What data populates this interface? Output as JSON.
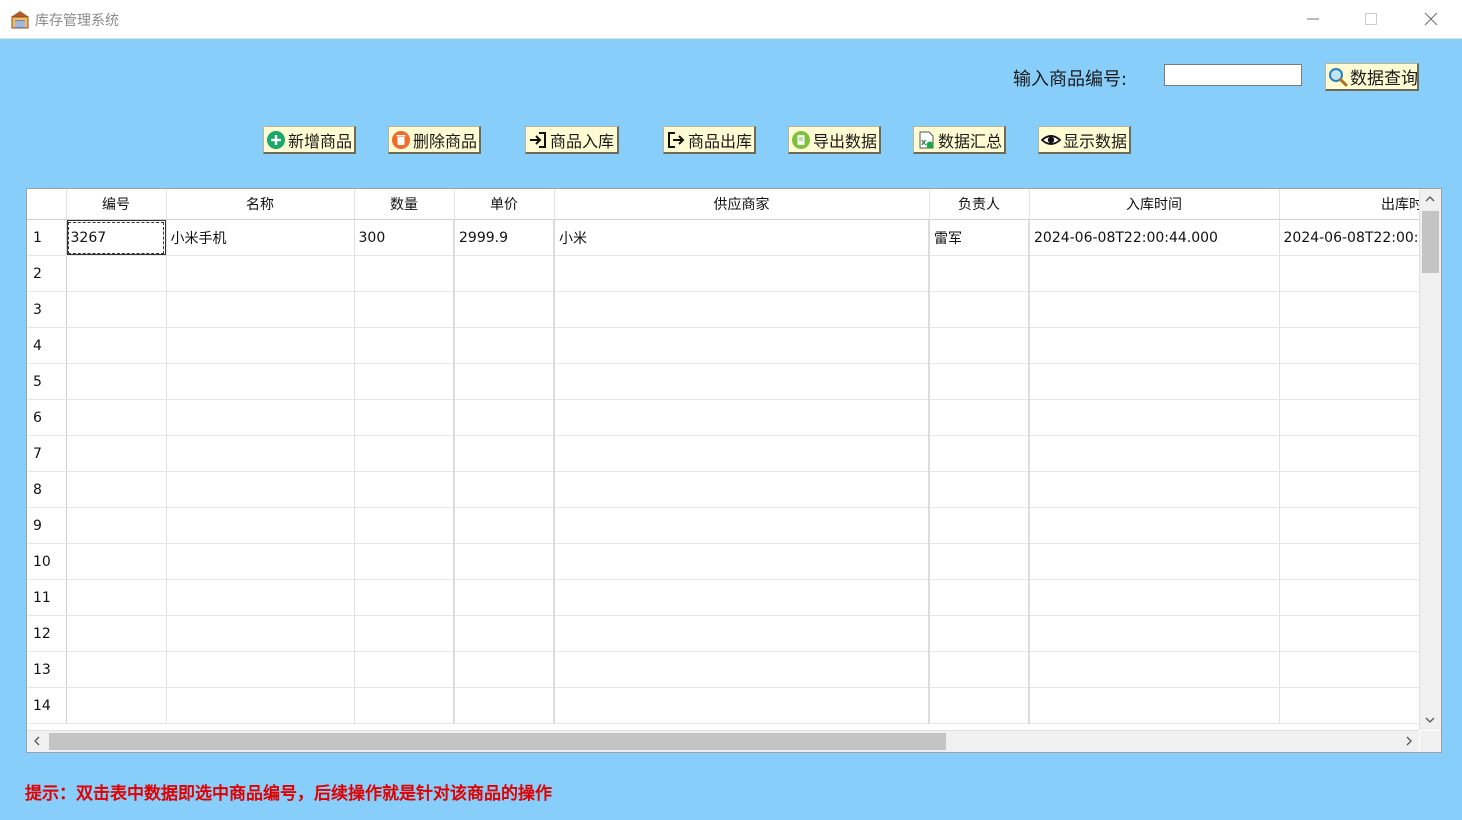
{
  "window": {
    "title": "库存管理系统",
    "icon": "warehouse-icon"
  },
  "search": {
    "label": "输入商品编号:",
    "value": "",
    "button_label": "数据查询",
    "button_icon": "magnifier-icon"
  },
  "toolbar": {
    "add_label": "新增商品",
    "delete_label": "删除商品",
    "stock_in_label": "商品入库",
    "stock_out_label": "商品出库",
    "export_label": "导出数据",
    "summary_label": "数据汇总",
    "show_label": "显示数据"
  },
  "table": {
    "columns": [
      "编号",
      "名称",
      "数量",
      "单价",
      "供应商家",
      "负责人",
      "入库时间",
      "出库时"
    ],
    "rows": [
      {
        "n": "1",
        "cells": [
          "3267",
          "小米手机",
          "300",
          "2999.9",
          "小米",
          "雷军",
          "2024-06-08T22:00:44.000",
          "2024-06-08T22:00:"
        ]
      },
      {
        "n": "2",
        "cells": [
          "",
          "",
          "",
          "",
          "",
          "",
          "",
          ""
        ]
      },
      {
        "n": "3",
        "cells": [
          "",
          "",
          "",
          "",
          "",
          "",
          "",
          ""
        ]
      },
      {
        "n": "4",
        "cells": [
          "",
          "",
          "",
          "",
          "",
          "",
          "",
          ""
        ]
      },
      {
        "n": "5",
        "cells": [
          "",
          "",
          "",
          "",
          "",
          "",
          "",
          ""
        ]
      },
      {
        "n": "6",
        "cells": [
          "",
          "",
          "",
          "",
          "",
          "",
          "",
          ""
        ]
      },
      {
        "n": "7",
        "cells": [
          "",
          "",
          "",
          "",
          "",
          "",
          "",
          ""
        ]
      },
      {
        "n": "8",
        "cells": [
          "",
          "",
          "",
          "",
          "",
          "",
          "",
          ""
        ]
      },
      {
        "n": "9",
        "cells": [
          "",
          "",
          "",
          "",
          "",
          "",
          "",
          ""
        ]
      },
      {
        "n": "10",
        "cells": [
          "",
          "",
          "",
          "",
          "",
          "",
          "",
          ""
        ]
      },
      {
        "n": "11",
        "cells": [
          "",
          "",
          "",
          "",
          "",
          "",
          "",
          ""
        ]
      },
      {
        "n": "12",
        "cells": [
          "",
          "",
          "",
          "",
          "",
          "",
          "",
          ""
        ]
      },
      {
        "n": "13",
        "cells": [
          "",
          "",
          "",
          "",
          "",
          "",
          "",
          ""
        ]
      },
      {
        "n": "14",
        "cells": [
          "",
          "",
          "",
          "",
          "",
          "",
          "",
          ""
        ]
      }
    ]
  },
  "hint": "提示：双击表中数据即选中商品编号，后续操作就是针对该商品的操作",
  "colors": {
    "background": "#87cefa",
    "button_face": "#fffbd2",
    "hint": "#e00000"
  }
}
